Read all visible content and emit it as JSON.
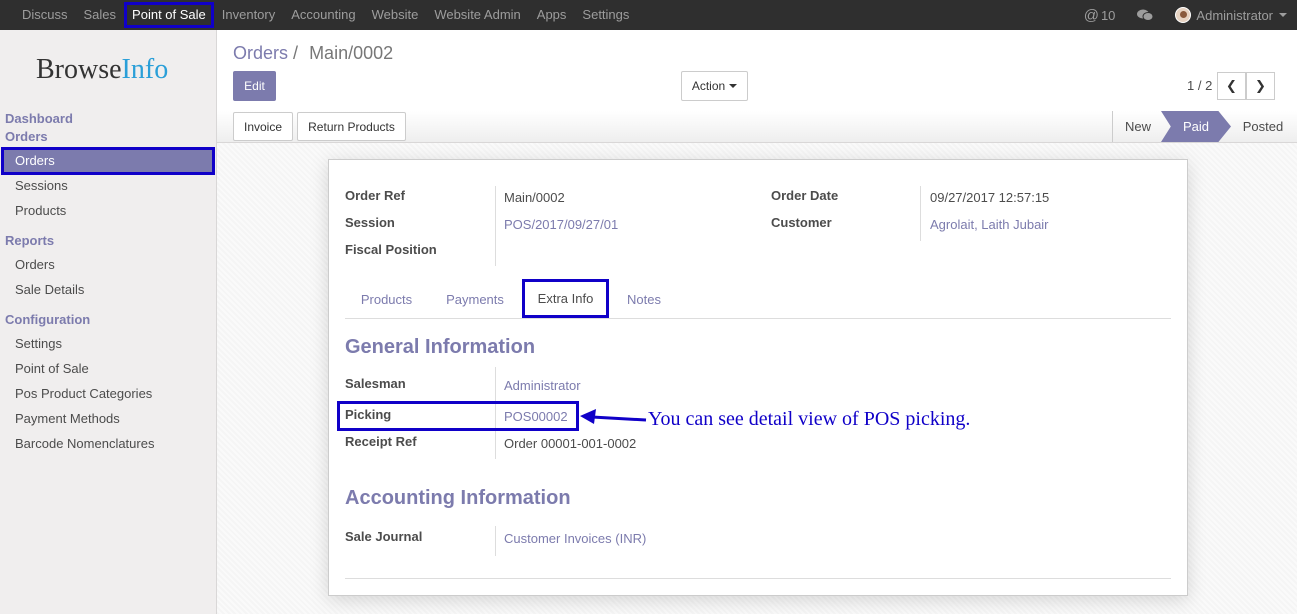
{
  "topbar": {
    "menu": [
      "Discuss",
      "Sales",
      "Point of Sale",
      "Inventory",
      "Accounting",
      "Website",
      "Website Admin",
      "Apps",
      "Settings"
    ],
    "active_menu": "Point of Sale",
    "notifications": "10",
    "user": "Administrator"
  },
  "sidebar": {
    "logo_browse": "Browse",
    "logo_info": "Info",
    "dashboard": "Dashboard",
    "orders_section": "Orders",
    "orders_items": [
      "Orders",
      "Sessions",
      "Products"
    ],
    "reports_section": "Reports",
    "reports_items": [
      "Orders",
      "Sale Details"
    ],
    "configuration_section": "Configuration",
    "configuration_items": [
      "Settings",
      "Point of Sale",
      "Pos Product Categories",
      "Payment Methods",
      "Barcode Nomenclatures"
    ]
  },
  "control_panel": {
    "breadcrumb_parent": "Orders",
    "breadcrumb_sep": "/",
    "breadcrumb_current": "Main/0002",
    "edit": "Edit",
    "action": "Action",
    "pager": "1 / 2"
  },
  "statusbar": {
    "invoice": "Invoice",
    "return_products": "Return Products",
    "stages": [
      "New",
      "Paid",
      "Posted"
    ],
    "current_stage": "Paid"
  },
  "form": {
    "order_ref_label": "Order Ref",
    "order_ref": "Main/0002",
    "session_label": "Session",
    "session": "POS/2017/09/27/01",
    "fiscal_position_label": "Fiscal Position",
    "order_date_label": "Order Date",
    "order_date": "09/27/2017 12:57:15",
    "customer_label": "Customer",
    "customer": "Agrolait, Laith Jubair",
    "tabs": [
      "Products",
      "Payments",
      "Extra Info",
      "Notes"
    ],
    "active_tab": "Extra Info",
    "general_title": "General Information",
    "salesman_label": "Salesman",
    "salesman": "Administrator",
    "picking_label": "Picking",
    "picking": "POS00002",
    "receipt_ref_label": "Receipt Ref",
    "receipt_ref": "Order 00001-001-0002",
    "accounting_title": "Accounting Information",
    "sale_journal_label": "Sale Journal",
    "sale_journal": "Customer Invoices (INR)"
  },
  "annotation": "You can see detail view of POS picking.",
  "colors": {
    "accent": "#7c7bad",
    "highlight": "#1000c8",
    "topbar": "#2f2f2f"
  }
}
